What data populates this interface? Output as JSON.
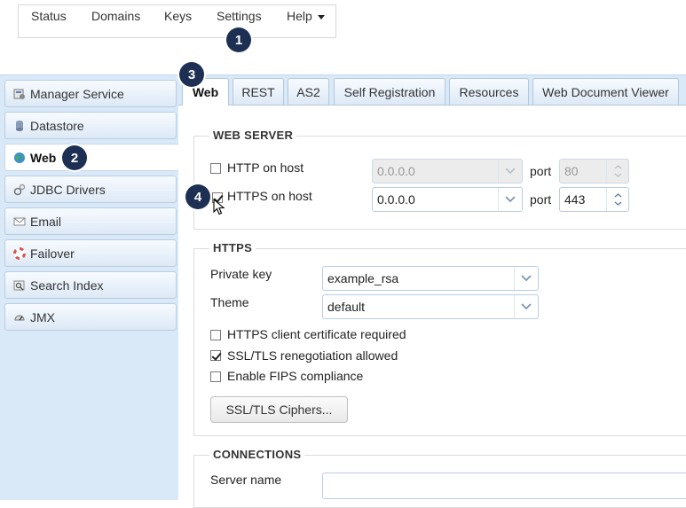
{
  "menu": {
    "items": [
      "Status",
      "Domains",
      "Keys",
      "Settings",
      "Help"
    ]
  },
  "badges": [
    "1",
    "2",
    "3",
    "4"
  ],
  "sidebar": {
    "items": [
      {
        "label": "Manager Service",
        "icon": "manager-service-icon"
      },
      {
        "label": "Datastore",
        "icon": "datastore-icon"
      },
      {
        "label": "Web",
        "icon": "globe-icon",
        "active": true
      },
      {
        "label": "JDBC Drivers",
        "icon": "jdbc-drivers-icon"
      },
      {
        "label": "Email",
        "icon": "envelope-icon"
      },
      {
        "label": "Failover",
        "icon": "lifebuoy-icon"
      },
      {
        "label": "Search Index",
        "icon": "search-index-icon"
      },
      {
        "label": "JMX",
        "icon": "gauge-icon"
      }
    ]
  },
  "tabs": [
    "Web",
    "REST",
    "AS2",
    "Self Registration",
    "Resources",
    "Web Document Viewer"
  ],
  "web_server": {
    "legend": "WEB SERVER",
    "http": {
      "label": "HTTP on host",
      "checked": false,
      "host": "0.0.0.0",
      "port_label": "port",
      "port": "80"
    },
    "https": {
      "label": "HTTPS on host",
      "checked": true,
      "host": "0.0.0.0",
      "port_label": "port",
      "port": "443"
    }
  },
  "https": {
    "legend": "HTTPS",
    "private_key_label": "Private key",
    "private_key_value": "example_rsa",
    "theme_label": "Theme",
    "theme_value": "default",
    "client_cert_label": "HTTPS client certificate required",
    "client_cert_checked": false,
    "renegotiation_label": "SSL/TLS renegotiation allowed",
    "renegotiation_checked": true,
    "fips_label": "Enable FIPS compliance",
    "fips_checked": false,
    "ciphers_button": "SSL/TLS Ciphers..."
  },
  "connections": {
    "legend": "CONNECTIONS",
    "server_name_label": "Server name",
    "server_name_value": ""
  },
  "colors": {
    "badge": "#1d2f52",
    "sidebar_bg": "#d9e9f8",
    "border": "#b9cde2"
  }
}
